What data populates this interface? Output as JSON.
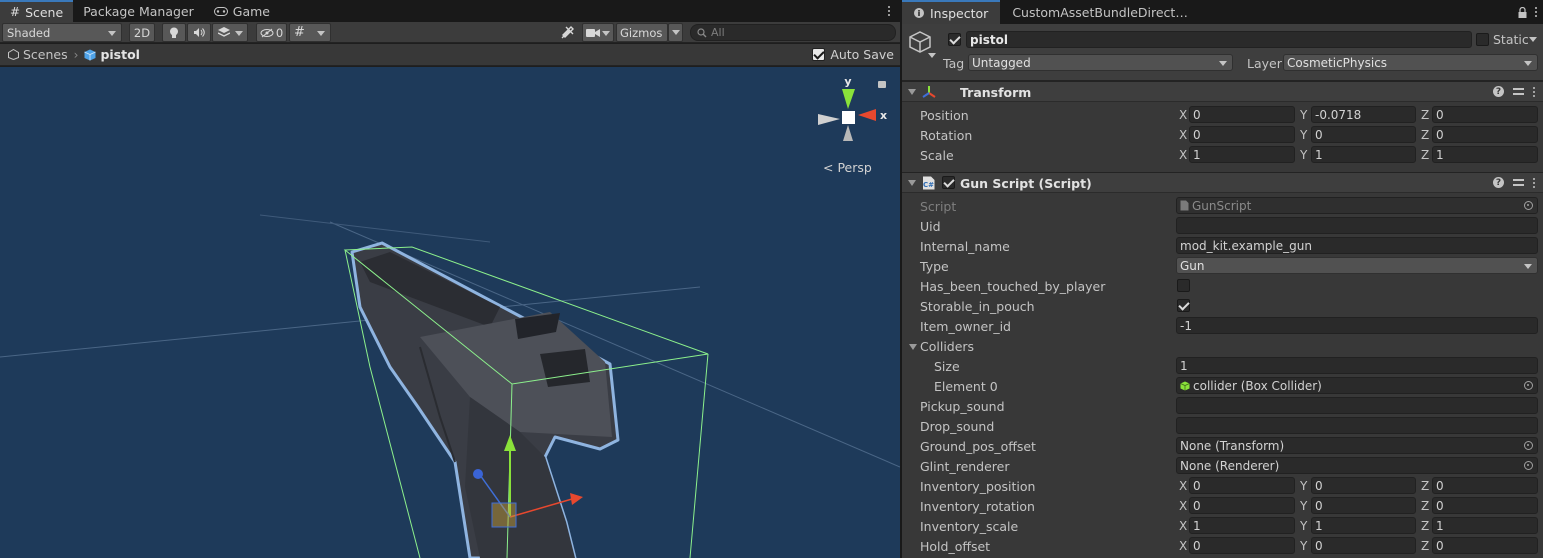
{
  "scene_tabs": [
    {
      "label": "Scene",
      "icon": "hash-grid-icon"
    },
    {
      "label": "Package Manager",
      "icon": ""
    },
    {
      "label": "Game",
      "icon": "gamepad-icon"
    }
  ],
  "scene_toolbar": {
    "draw_mode": "Shaded",
    "mode_2d": "2D",
    "hidden_count": "0",
    "gizmos_label": "Gizmos",
    "search_placeholder": "All"
  },
  "breadcrumb": {
    "root": "Scenes",
    "current": "pistol",
    "auto_save_label": "Auto Save",
    "auto_save_checked": true
  },
  "viewport": {
    "orientation_label": "Persp",
    "gizmo_axes": {
      "y": "y",
      "x": "x"
    },
    "background_color": "#1e3a5a",
    "selection_outline_color": "#8fb4e0",
    "bounds_color": "#8cf08c"
  },
  "inspector_tabs": [
    {
      "label": "Inspector",
      "icon": "info-icon"
    },
    {
      "label": "CustomAssetBundleDirect…",
      "icon": ""
    }
  ],
  "gameobject": {
    "name": "pistol",
    "active": true,
    "static_label": "Static",
    "tag_label": "Tag",
    "tag_value": "Untagged",
    "layer_label": "Layer",
    "layer_value": "CosmeticPhysics"
  },
  "transform": {
    "title": "Transform",
    "rows": [
      {
        "label": "Position",
        "x": "0",
        "y": "-0.0718",
        "z": "0"
      },
      {
        "label": "Rotation",
        "x": "0",
        "y": "0",
        "z": "0"
      },
      {
        "label": "Scale",
        "x": "1",
        "y": "1",
        "z": "1"
      }
    ]
  },
  "gun_script": {
    "title": "Gun Script (Script)",
    "enabled": true,
    "script_label": "Script",
    "script_value": "GunScript",
    "uid_label": "Uid",
    "uid_value": "",
    "internal_name_label": "Internal_name",
    "internal_name_value": "mod_kit.example_gun",
    "type_label": "Type",
    "type_value": "Gun",
    "touched_label": "Has_been_touched_by_player",
    "touched_value": false,
    "storable_label": "Storable_in_pouch",
    "storable_value": true,
    "owner_label": "Item_owner_id",
    "owner_value": "-1",
    "colliders_label": "Colliders",
    "size_label": "Size",
    "size_value": "1",
    "element0_label": "Element 0",
    "element0_value": "collider (Box Collider)",
    "pickup_label": "Pickup_sound",
    "pickup_value": "",
    "drop_label": "Drop_sound",
    "drop_value": "",
    "ground_label": "Ground_pos_offset",
    "ground_value": "None (Transform)",
    "glint_label": "Glint_renderer",
    "glint_value": "None (Renderer)",
    "vec_rows": [
      {
        "label": "Inventory_position",
        "x": "0",
        "y": "0",
        "z": "0"
      },
      {
        "label": "Inventory_rotation",
        "x": "0",
        "y": "0",
        "z": "0"
      },
      {
        "label": "Inventory_scale",
        "x": "1",
        "y": "1",
        "z": "1"
      },
      {
        "label": "Hold_offset",
        "x": "0",
        "y": "0",
        "z": "0"
      }
    ]
  },
  "axis_labels": {
    "x": "X",
    "y": "Y",
    "z": "Z"
  }
}
